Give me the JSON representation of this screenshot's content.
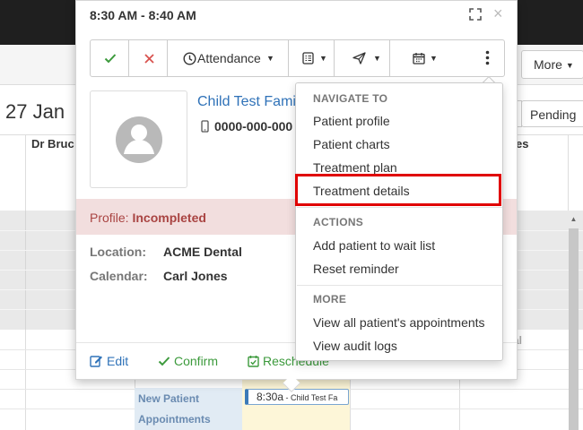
{
  "background": {
    "more_label": "More",
    "date_title": "27 Jan",
    "pending_label": "Pending",
    "doctor_column": "Dr Bruc",
    "column_fragment": "es",
    "slot_labels": [
      "New Patient",
      "Appointments"
    ],
    "slot_fragment": "tal",
    "appointment": {
      "time": "8:30a",
      "separator": " - ",
      "name": "Child Test Fa"
    }
  },
  "popover": {
    "time_range": "8:30 AM - 8:40 AM",
    "close_symbol": "×",
    "toolbar": {
      "attendance_label": "Attendance"
    },
    "patient": {
      "name": "Child Test Family",
      "phone": "0000-000-000"
    },
    "profile": {
      "label": "Profile:",
      "status": "Incompleted"
    },
    "location_label": "Location:",
    "location_value": "ACME Dental",
    "calendar_label": "Calendar:",
    "calendar_value": "Carl Jones",
    "footer": {
      "edit": "Edit",
      "confirm": "Confirm",
      "reschedule": "Reschedule"
    }
  },
  "menu": {
    "navigate_header": "NAVIGATE TO",
    "navigate_items": [
      "Patient profile",
      "Patient charts",
      "Treatment plan",
      "Treatment details"
    ],
    "actions_header": "ACTIONS",
    "actions_items": [
      "Add patient to wait list",
      "Reset reminder"
    ],
    "more_header": "MORE",
    "more_items": [
      "View all patient's appointments",
      "View audit logs"
    ],
    "highlighted_item": "Treatment details"
  },
  "colors": {
    "accent_blue": "#2f72b8",
    "success_green": "#3c9a3c",
    "danger_red": "#d9534f",
    "highlight_red": "#e00000",
    "profile_band": "#f2dede"
  }
}
